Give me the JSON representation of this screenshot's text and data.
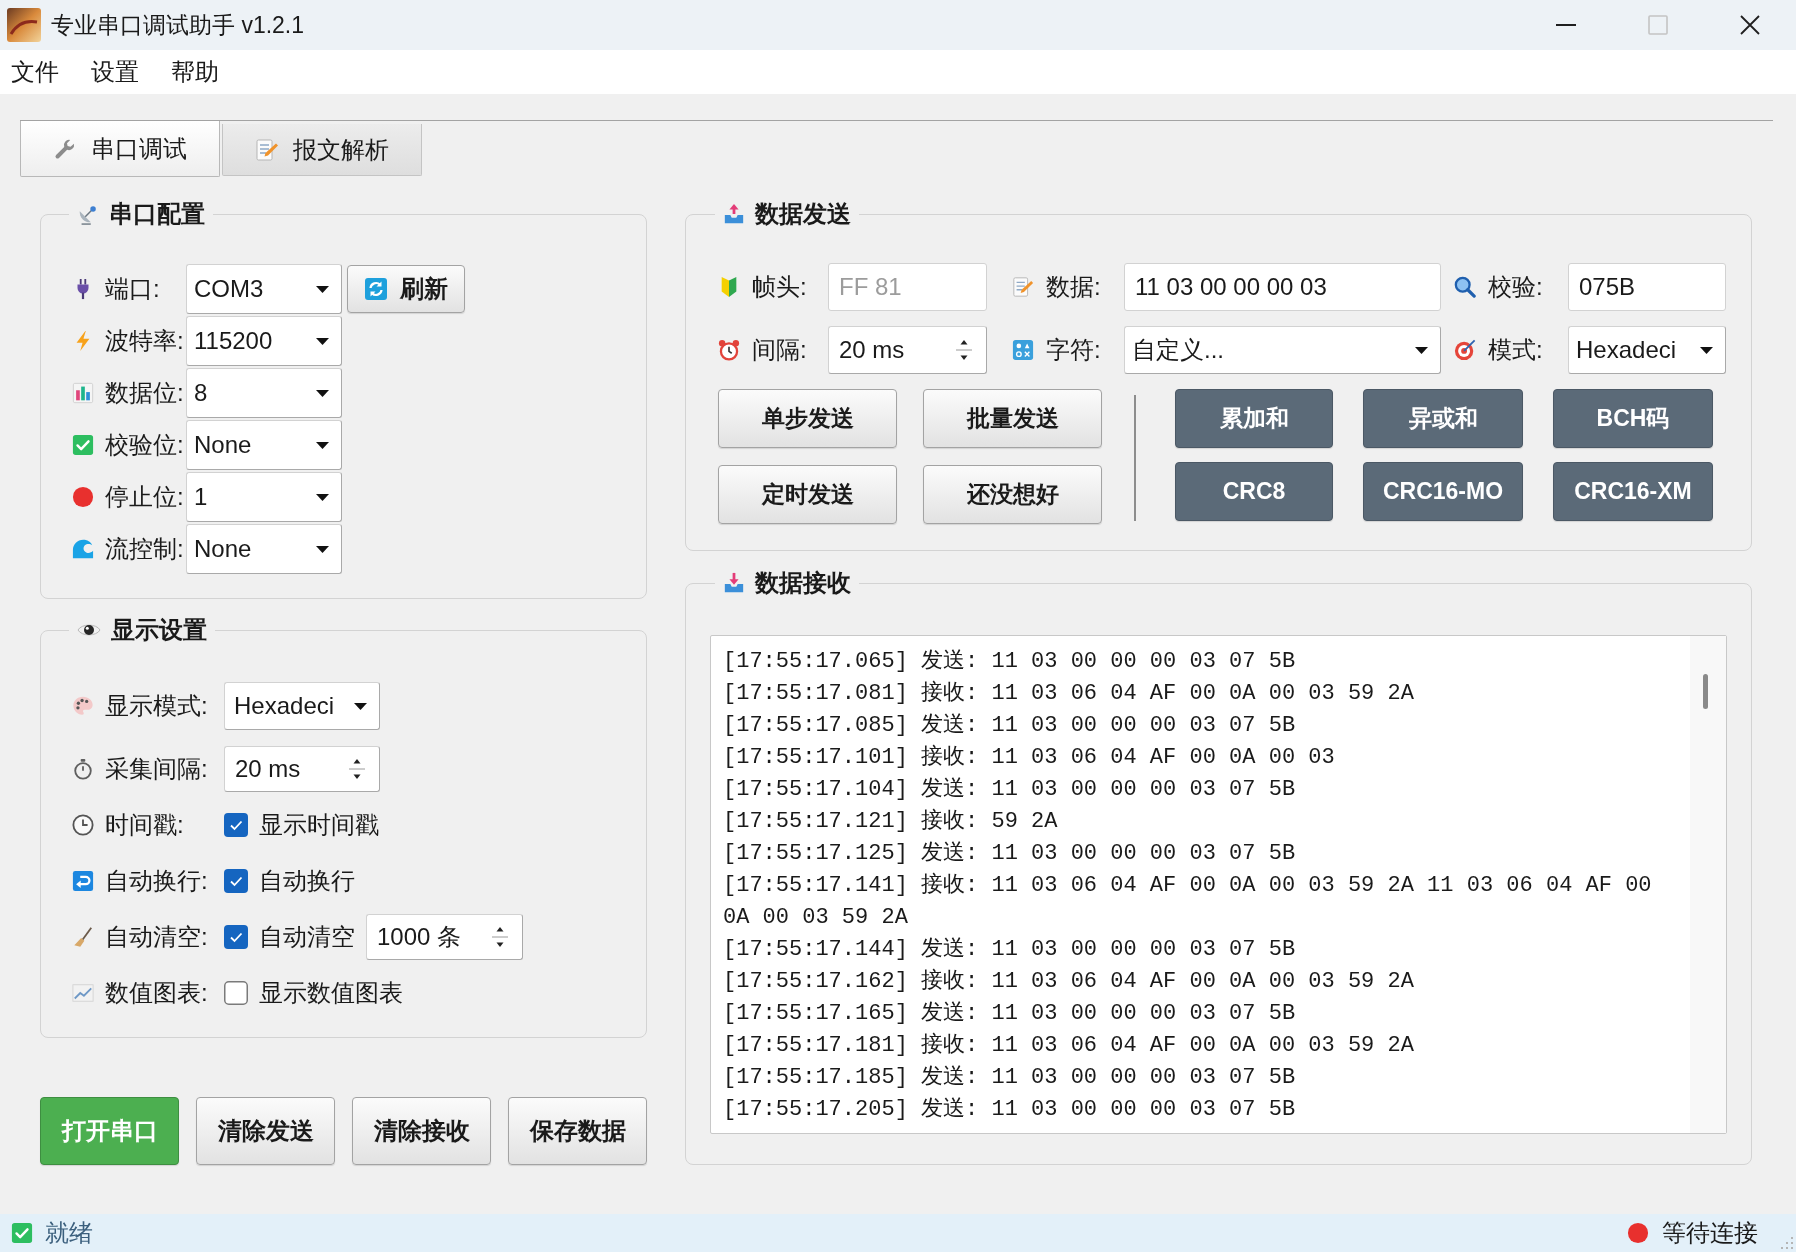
{
  "window": {
    "title": "专业串口调试助手 v1.2.1",
    "controls": [
      {
        "kind": "minimize",
        "disabled": false
      },
      {
        "kind": "maximize",
        "disabled": true
      },
      {
        "kind": "close",
        "disabled": false
      }
    ]
  },
  "menu": [
    {
      "label": "文件"
    },
    {
      "label": "设置"
    },
    {
      "label": "帮助"
    }
  ],
  "tabs": [
    {
      "label": "串口调试",
      "selected": true
    },
    {
      "label": "报文解析",
      "selected": false
    }
  ],
  "serial_config": {
    "title": "串口配置",
    "fields": [
      {
        "label": "端口:",
        "value": "COM3"
      },
      {
        "label": "波特率:",
        "value": "115200"
      },
      {
        "label": "数据位:",
        "value": "8"
      },
      {
        "label": "校验位:",
        "value": "None"
      },
      {
        "label": "停止位:",
        "value": "1"
      },
      {
        "label": "流控制:",
        "value": "None"
      }
    ],
    "refresh_button": "刷新"
  },
  "display_settings": {
    "title": "显示设置",
    "rows": [
      {
        "kind": "combo",
        "label": "显示模式:",
        "value": "Hexadeci"
      },
      {
        "kind": "spin",
        "label": "采集间隔:",
        "value": "20 ms"
      },
      {
        "kind": "check",
        "label": "时间戳:",
        "check_label": "显示时间戳",
        "checked": true
      },
      {
        "kind": "check",
        "label": "自动换行:",
        "check_label": "自动换行",
        "checked": true
      },
      {
        "kind": "check_spin",
        "label": "自动清空:",
        "check_label": "自动清空",
        "checked": true,
        "value": "1000 条"
      },
      {
        "kind": "check",
        "label": "数值图表:",
        "check_label": "显示数值图表",
        "checked": false
      }
    ]
  },
  "actions": [
    {
      "label": "打开串口",
      "kind": "primary"
    },
    {
      "label": "清除发送",
      "kind": "default"
    },
    {
      "label": "清除接收",
      "kind": "default"
    },
    {
      "label": "保存数据",
      "kind": "default"
    }
  ],
  "data_send": {
    "title": "数据发送",
    "fields": [
      {
        "kind": "text",
        "label": "帧头:",
        "placeholder": "FF 81"
      },
      {
        "kind": "text",
        "label": "数据:",
        "value": "11 03 00 00 00 03"
      },
      {
        "kind": "text",
        "label": "校验:",
        "value": "075B"
      },
      {
        "kind": "spin",
        "label": "间隔:",
        "value": "20 ms"
      },
      {
        "kind": "combo",
        "label": "字符:",
        "value": "自定义..."
      },
      {
        "kind": "combo",
        "label": "模式:",
        "value": "Hexadeci"
      }
    ],
    "send_buttons": [
      "单步发送",
      "批量发送",
      "定时发送",
      "还没想好"
    ],
    "checksum_buttons": [
      "累加和",
      "异或和",
      "BCH码",
      "CRC8",
      "CRC16-MO",
      "CRC16-XM"
    ]
  },
  "data_receive": {
    "title": "数据接收",
    "lines": [
      "[17:55:17.065] 发送: 11 03 00 00 00 03 07 5B",
      "[17:55:17.081] 接收: 11 03 06 04 AF 00 0A 00 03 59 2A",
      "[17:55:17.085] 发送: 11 03 00 00 00 03 07 5B",
      "[17:55:17.101] 接收: 11 03 06 04 AF 00 0A 00 03",
      "[17:55:17.104] 发送: 11 03 00 00 00 03 07 5B",
      "[17:55:17.121] 接收: 59 2A",
      "[17:55:17.125] 发送: 11 03 00 00 00 03 07 5B",
      "[17:55:17.141] 接收: 11 03 06 04 AF 00 0A 00 03 59 2A 11 03 06 04 AF 00 0A 00 03 59 2A",
      "[17:55:17.144] 发送: 11 03 00 00 00 03 07 5B",
      "[17:55:17.162] 接收: 11 03 06 04 AF 00 0A 00 03 59 2A",
      "[17:55:17.165] 发送: 11 03 00 00 00 03 07 5B",
      "[17:55:17.181] 接收: 11 03 06 04 AF 00 0A 00 03 59 2A",
      "[17:55:17.185] 发送: 11 03 00 00 00 03 07 5B",
      "[17:55:17.205] 发送: 11 03 00 00 00 03 07 5B"
    ]
  },
  "status_bar": {
    "message": "就绪",
    "connection": "等待连接"
  }
}
